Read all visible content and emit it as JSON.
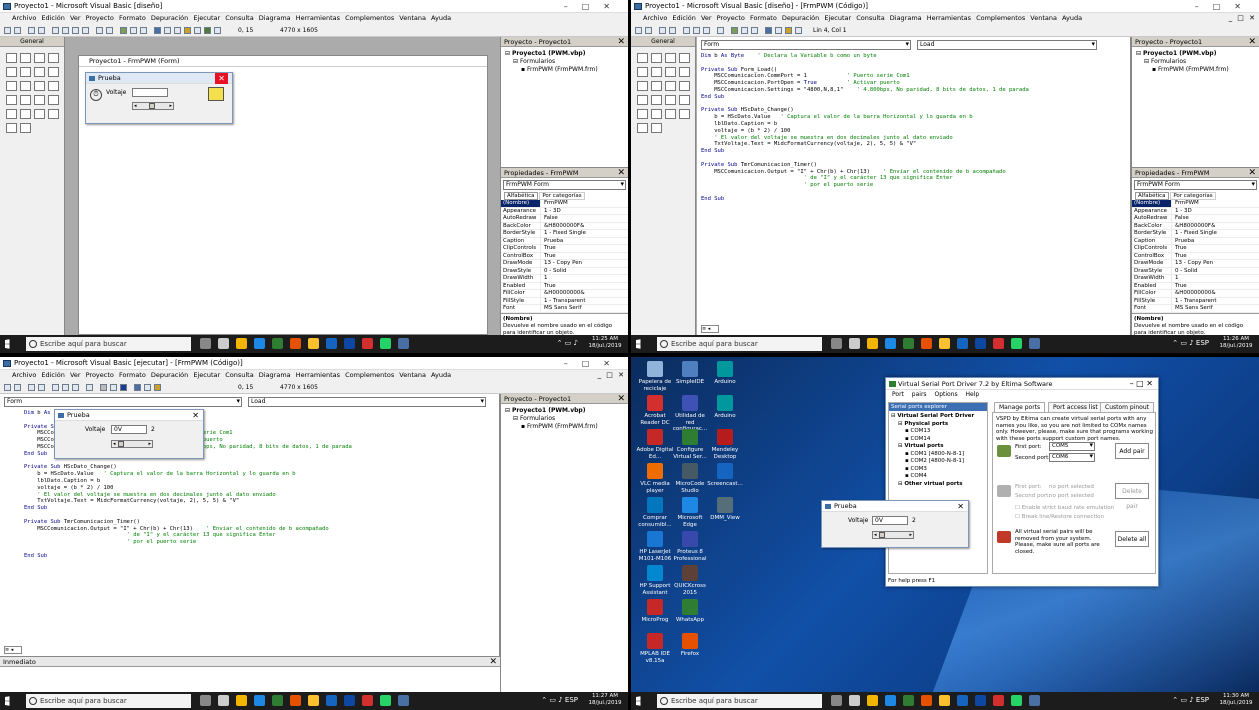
{
  "vb_title_design": "Proyecto1 - Microsoft Visual Basic [diseño]",
  "vb_title_code": "Proyecto1 - Microsoft Visual Basic [diseño] - [FrmPWM (Código)]",
  "vb_title_exec": "Proyecto1 - Microsoft Visual Basic [ejecutar] - [FrmPWM (Código)]",
  "menu": "Archivo  Edición  Ver  Proyecto  Formato  Depuración  Ejecutar  Consulta  Diagrama  Herramientas  Complementos  Ventana  Ayuda",
  "toolbar_pos_design": "0, 15",
  "toolbar_size": "4770 x 1605",
  "toolbar_pos_code": "Lin 4, Col 1",
  "toolbox_title": "General",
  "form_window_title": "Proyecto1 - FrmPWM (Form)",
  "form_caption": "Prueba",
  "label_voltaje": "Voltaje",
  "project_title": "Proyecto - Proyecto1",
  "project_tree": [
    "Proyecto1 (PWM.vbp)",
    "Formularios",
    "FrmPWM (FrmPWM.frm)"
  ],
  "props_title": "Propiedades - FrmPWM",
  "props_combo": "FrmPWM Form",
  "props_tab1": "Alfabética",
  "props_tab2": "Por categorías",
  "props_rows": [
    {
      "n": "(Nombre)",
      "v": "FrmPWM"
    },
    {
      "n": "Appearance",
      "v": "1 - 3D"
    },
    {
      "n": "AutoRedraw",
      "v": "False"
    },
    {
      "n": "BackColor",
      "v": "&H8000000F&"
    },
    {
      "n": "BorderStyle",
      "v": "1 - Fixed Single"
    },
    {
      "n": "Caption",
      "v": "Prueba"
    },
    {
      "n": "ClipControls",
      "v": "True"
    },
    {
      "n": "ControlBox",
      "v": "True"
    },
    {
      "n": "DrawMode",
      "v": "13 - Copy Pen"
    },
    {
      "n": "DrawStyle",
      "v": "0 - Solid"
    },
    {
      "n": "DrawWidth",
      "v": "1"
    },
    {
      "n": "Enabled",
      "v": "True"
    },
    {
      "n": "FillColor",
      "v": "&H00000000&"
    },
    {
      "n": "FillStyle",
      "v": "1 - Transparent"
    },
    {
      "n": "Font",
      "v": "MS Sans Serif"
    }
  ],
  "props_desc_title": "(Nombre)",
  "props_desc": "Devuelve el nombre usado en el código para identificar un objeto.",
  "combo_object": "Form",
  "combo_proc": "Load",
  "code_lines": [
    "Dim b As Byte    ' Declara la Variable b como un byte",
    "",
    "Private Sub Form_Load()",
    "    MSCComunicacion.CommPort = 1            ' Puerto serie Com1",
    "    MSCComunicacion.PortOpen = True         ' Activar puerto",
    "    MSCComunicacion.Settings = \"4800,N,8,1\"    ' 4.800bps, No paridad, 8 bits de datos, 1 de parada",
    "End Sub",
    "",
    "Private Sub HScDato_Change()",
    "    b = HScDato.Value   ' Captura el valor de la barra Horizontal y lo guarda en b",
    "    lblDato.Caption = b",
    "    voltaje = (b * 2) / 100",
    "    ' El valor del voltaje se muestra en dos decimales junto al dato enviado",
    "    TxtVoltaje.Text = MidcFormatCurrency(voltaje, 2), 5, 5) & \"V\"",
    "End Sub",
    "",
    "Private Sub TmrComunicacion_Timer()",
    "    MSCComunicacion.Output = \"I\" + Chr(b) + Chr(13)    ' Enviar el contenido de b acompañado",
    "                               ' de \"I\" y el carácter 13 que significa Enter",
    "                               ' por el puerto serie",
    "",
    "End Sub"
  ],
  "immediate_title": "Inmediato",
  "run_field_value": "0V",
  "run_label_value": "2",
  "taskbar_search": "Escribe aquí para buscar",
  "tray_lang": "ESP",
  "clock": [
    {
      "time": "11:25 AM",
      "date": "18/jul./2019"
    },
    {
      "time": "11:26 AM",
      "date": "18/jul./2019"
    },
    {
      "time": "11:27 AM",
      "date": "18/jul./2019"
    },
    {
      "time": "11:30 AM",
      "date": "18/jul./2019"
    }
  ],
  "desktop_icons": [
    {
      "label": "Papelera de reciclaje",
      "color": "#8fb3d9"
    },
    {
      "label": "SimpleIDE",
      "color": "#4f7fbf"
    },
    {
      "label": "Arduino",
      "color": "#00979d"
    },
    {
      "label": "Acrobat Reader DC",
      "color": "#d32f2f"
    },
    {
      "label": "Utilidad de red configurac...",
      "color": "#3f51b5"
    },
    {
      "label": "Arduino",
      "color": "#00979d"
    },
    {
      "label": "Adobe Digital Ed...",
      "color": "#c62828"
    },
    {
      "label": "Configure Virtual Ser...",
      "color": "#2e7d32"
    },
    {
      "label": "Mendeley Desktop",
      "color": "#b71c1c"
    },
    {
      "label": "VLC media player",
      "color": "#ef6c00"
    },
    {
      "label": "MicroCode Studio",
      "color": "#455a64"
    },
    {
      "label": "Screencast...",
      "color": "#1565c0"
    },
    {
      "label": "Comprar consumibl...",
      "color": "#0277bd"
    },
    {
      "label": "Microsoft Edge",
      "color": "#1e88e5"
    },
    {
      "label": "DMM_View",
      "color": "#546e7a"
    },
    {
      "label": "HP LaserJet M101-M106",
      "color": "#1976d2"
    },
    {
      "label": "Proteus 8 Professional",
      "color": "#3949ab"
    },
    {
      "label": "HP Support Assistant",
      "color": "#0288d1"
    },
    {
      "label": "QUICKcross 2015",
      "color": "#5d4037"
    },
    {
      "label": "MicroProg",
      "color": "#c62828"
    },
    {
      "label": "WhatsApp",
      "color": "#2e7d32"
    },
    {
      "label": "MPLAB IDE v8.15a",
      "color": "#c62828"
    },
    {
      "label": "Firefox",
      "color": "#e65100"
    }
  ],
  "vsp": {
    "title": "Virtual Serial Port Driver 7.2 by Eltima Software",
    "menu": [
      "Port pairs",
      "Options",
      "Help"
    ],
    "explorer_title": "Serial ports explorer",
    "tree": [
      "Virtual Serial Port Driver",
      "Physical ports",
      "COM13",
      "COM14",
      "Virtual ports",
      "COM1 [4800-N-8-1]",
      "COM2 [4800-N-8-1]",
      "COM3",
      "COM4",
      "Other virtual ports"
    ],
    "tabs": [
      "Manage ports",
      "Port access list",
      "Custom pinout"
    ],
    "intro": "VSPD by Eltima can create virtual serial ports with any names you like, so you are not limited to COMx names only. However, please, make sure that programs working with these ports support custom port names.",
    "first_port_label": "First port:",
    "first_port": "COM5",
    "second_port_label": "Second port:",
    "second_port": "COM6",
    "add_pair": "Add pair",
    "del_first_label": "First port:",
    "del_first": "no port selected",
    "del_second_label": "Second port:",
    "del_second": "no port selected",
    "delete_pair": "Delete pair",
    "opt1": "Enable strict baud rate emulation",
    "opt2": "Break line/Restore connection",
    "remove_text": "All virtual serial pairs will be removed from your system. Please, make sure all ports are closed.",
    "delete_all": "Delete all",
    "status": "For help press F1"
  }
}
